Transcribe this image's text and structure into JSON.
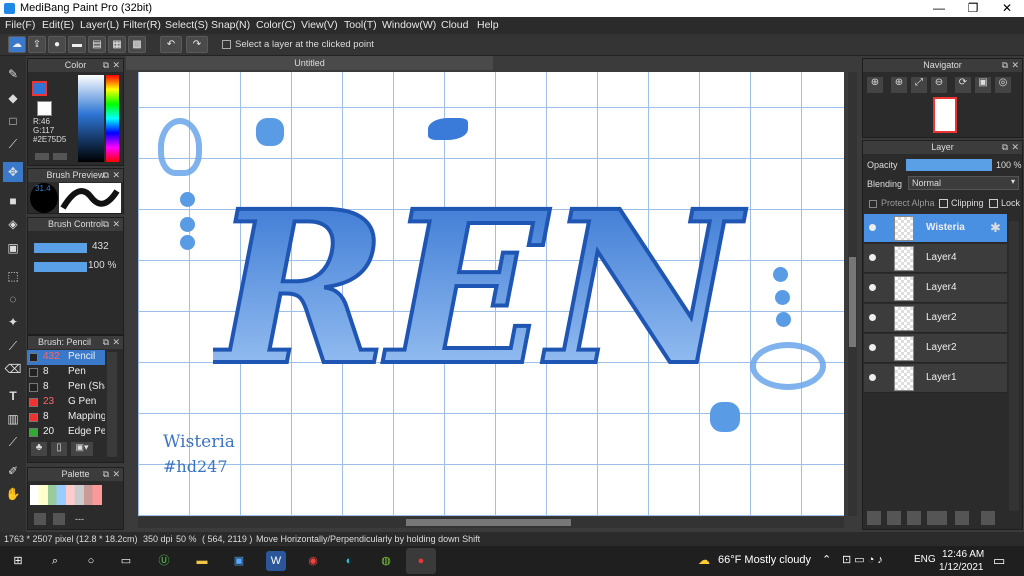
{
  "window": {
    "title": "MediBang Paint Pro (32bit)",
    "minimize": "—",
    "maximize": "❐",
    "close": "✕"
  },
  "menu": [
    "File(F)",
    "Edit(E)",
    "Layer(L)",
    "Filter(R)",
    "Select(S)",
    "Snap(N)",
    "Color(C)",
    "View(V)",
    "Tool(T)",
    "Window(W)",
    "Cloud",
    "Help"
  ],
  "toolbar": {
    "select_layer_label": "Select a layer at the clicked point"
  },
  "canvas": {
    "tab_title": "Untitled",
    "lettering": "REN",
    "signature_name": "Wisteria",
    "signature_tag": "#hd247"
  },
  "color_panel": {
    "title": "Color",
    "r": "R:46",
    "g": "G:117",
    "hex": "#2E75D5",
    "main_color": "#2e75d5"
  },
  "brush_preview": {
    "title": "Brush Preview",
    "size": "31.4"
  },
  "brush_control": {
    "title": "Brush Control",
    "size": "432",
    "opacity": "100 %"
  },
  "brush_list": {
    "title": "Brush: Pencil",
    "items": [
      {
        "size": "432",
        "name": "Pencil",
        "color": "#222"
      },
      {
        "size": "8",
        "name": "Pen",
        "color": "#222"
      },
      {
        "size": "8",
        "name": "Pen (Sha",
        "color": "#222"
      },
      {
        "size": "23",
        "name": "G Pen",
        "color": "#e33"
      },
      {
        "size": "8",
        "name": "Mapping",
        "color": "#e33"
      },
      {
        "size": "20",
        "name": "Edge Per",
        "color": "#3a3"
      }
    ]
  },
  "palette": {
    "title": "Palette",
    "dash": "---"
  },
  "navigator": {
    "title": "Navigator"
  },
  "layer_panel": {
    "title": "Layer",
    "opacity_label": "Opacity",
    "opacity_value": "100 %",
    "blending_label": "Blending",
    "blending_value": "Normal",
    "protect_alpha": "Protect Alpha",
    "clipping": "Clipping",
    "lock": "Lock",
    "layers": [
      "Wisteria",
      "Layer4",
      "Layer4",
      "Layer2",
      "Layer2",
      "Layer1"
    ]
  },
  "status": {
    "size": "1763 * 2507 pixel",
    "cm": "(12.8 * 18.2cm)",
    "dpi": "350 dpi",
    "zoom": "50 %",
    "coords": "( 564, 2119 )",
    "hint": "Move Horizontally/Perpendicularly by holding down Shift"
  },
  "taskbar": {
    "weather": "66°F  Mostly cloudy",
    "lang": "ENG",
    "time": "12:46 AM",
    "date": "1/12/2021"
  }
}
